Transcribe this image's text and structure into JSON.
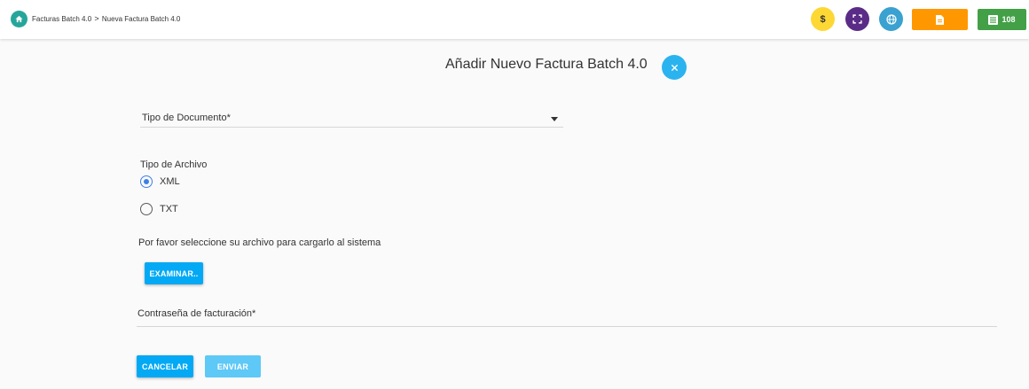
{
  "header": {
    "breadcrumb": [
      "Facturas Batch 4.0",
      "Nueva Factura Batch 4.0"
    ],
    "breadcrumb_separator": ">",
    "icons": {
      "home": "home-icon",
      "dollar": "$",
      "fullscreen": "fullscreen-icon",
      "globe": "globe-icon",
      "document": "document-icon",
      "list": "list-icon"
    },
    "counter": "108",
    "colors": {
      "home": "#26a69a",
      "dollar": "#fdd835",
      "fullscreen": "#5b2c87",
      "globe": "#3aa1d0",
      "document": "#ff9800",
      "counter": "#43a047"
    }
  },
  "form": {
    "title": "Añadir Nuevo Factura Batch 4.0",
    "document_type_label": "Tipo de Documento*",
    "file_type_label": "Tipo de Archivo",
    "file_type_options": [
      {
        "label": "XML",
        "selected": true
      },
      {
        "label": "TXT",
        "selected": false
      }
    ],
    "file_instruction": "Por favor seleccione su archivo para cargarlo al sistema",
    "browse_button": "EXAMINAR..",
    "password_label": "Contraseña de facturación*",
    "cancel_button": "CANCELAR",
    "submit_button": "ENVIAR",
    "accent_color": "#03a9f4"
  }
}
